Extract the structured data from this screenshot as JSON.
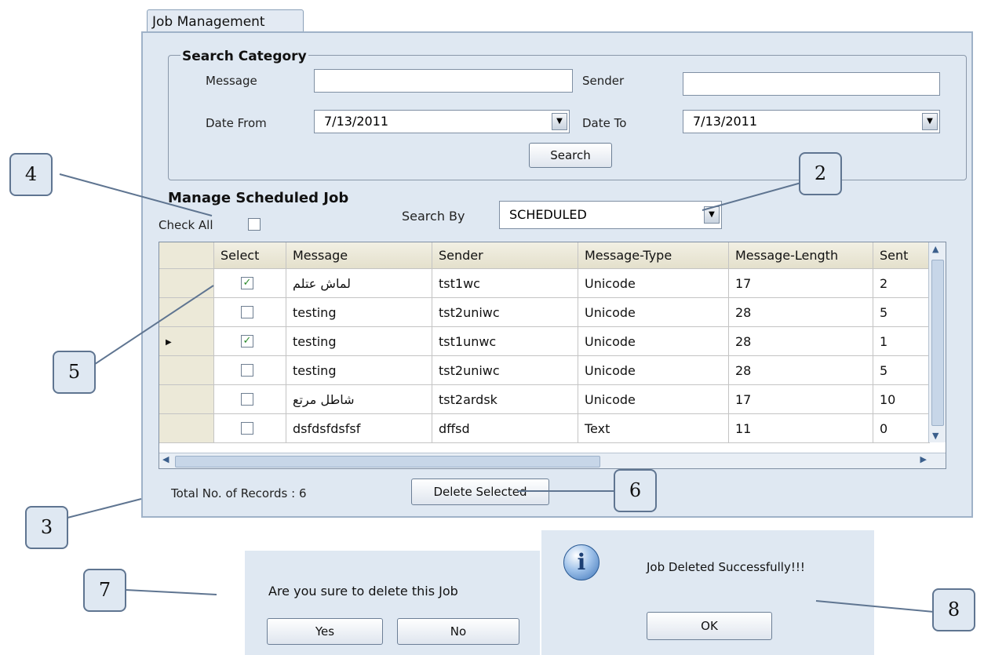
{
  "tab": {
    "label": "Job Management"
  },
  "search_category": {
    "title": "Search Category",
    "message_label": "Message",
    "message_value": "",
    "sender_label": "Sender",
    "sender_value": "",
    "date_from_label": "Date From",
    "date_from_value": "7/13/2011",
    "date_to_label": "Date To",
    "date_to_value": "7/13/2011",
    "search_button": "Search"
  },
  "manage": {
    "title": "Manage Scheduled Job",
    "check_all_label": "Check All",
    "search_by_label": "Search By",
    "search_by_value": "SCHEDULED"
  },
  "grid": {
    "columns": [
      "Select",
      "Message",
      "Sender",
      "Message-Type",
      "Message-Length",
      "Sent"
    ],
    "rows": [
      {
        "checked": true,
        "current": false,
        "message": "لماش عتلم",
        "sender": "tst1wc",
        "type": "Unicode",
        "length": "17",
        "sent": "2"
      },
      {
        "checked": false,
        "current": false,
        "message": "testing",
        "sender": "tst2uniwc",
        "type": "Unicode",
        "length": "28",
        "sent": "5"
      },
      {
        "checked": true,
        "current": true,
        "message": "testing",
        "sender": "tst1unwc",
        "type": "Unicode",
        "length": "28",
        "sent": "1"
      },
      {
        "checked": false,
        "current": false,
        "message": "testing",
        "sender": "tst2uniwc",
        "type": "Unicode",
        "length": "28",
        "sent": "5"
      },
      {
        "checked": false,
        "current": false,
        "message": "شاطل مرتع",
        "sender": "tst2ardsk",
        "type": "Unicode",
        "length": "17",
        "sent": "10"
      },
      {
        "checked": false,
        "current": false,
        "message": "dsfdsfdsfsf",
        "sender": "dffsd",
        "type": "Text",
        "length": "11",
        "sent": "0"
      }
    ]
  },
  "footer": {
    "total_label": "Total No. of Records : ",
    "total_value": "6",
    "delete_button": "Delete Selected"
  },
  "confirm_dialog": {
    "message": "Are you sure to delete this Job",
    "yes": "Yes",
    "no": "No"
  },
  "info_dialog": {
    "message": "Job Deleted Successfully!!!",
    "ok": "OK",
    "icon": "info-icon"
  },
  "callouts": [
    "2",
    "3",
    "4",
    "5",
    "6",
    "7",
    "8"
  ],
  "colors": {
    "panel": "#dfe8f2",
    "border": "#9fb2c8",
    "callout_border": "#5f7591"
  }
}
